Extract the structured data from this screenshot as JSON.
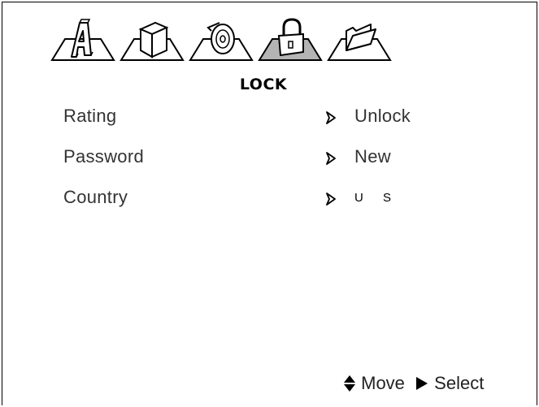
{
  "header": {
    "title": "LOCK"
  },
  "tabs": [
    {
      "id": "language",
      "icon": "letter-a-icon",
      "selected": false
    },
    {
      "id": "video",
      "icon": "cube-icon",
      "selected": false
    },
    {
      "id": "audio",
      "icon": "disc-icon",
      "selected": false
    },
    {
      "id": "lock",
      "icon": "padlock-icon",
      "selected": true
    },
    {
      "id": "misc",
      "icon": "folder-icon",
      "selected": false
    }
  ],
  "menu": {
    "items": [
      {
        "label": "Rating",
        "value": "Unlock"
      },
      {
        "label": "Password",
        "value": "New"
      },
      {
        "label": "Country",
        "value": "U S"
      }
    ]
  },
  "footer": {
    "move_label": "Move",
    "select_label": "Select",
    "move_icon": "updown-arrow-icon",
    "select_icon": "play-arrow-icon"
  },
  "colors": {
    "selected_tab_fill": "#b4b4b4",
    "text": "#333333"
  }
}
